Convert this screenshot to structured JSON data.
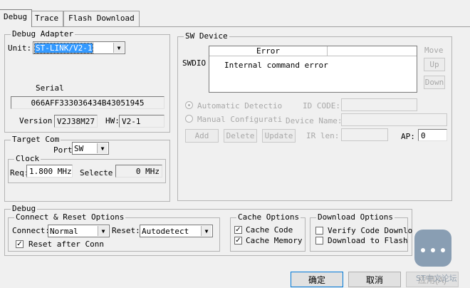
{
  "tabs": [
    {
      "label": "Debug"
    },
    {
      "label": "Trace"
    },
    {
      "label": "Flash Download"
    }
  ],
  "debug_adapter": {
    "title": "Debug Adapter",
    "unit_label": "Unit:",
    "unit_value": "ST-LINK/V2-1",
    "serial_label": "Serial",
    "serial_value": "066AFF333036434B43051945",
    "version_label": "Version:",
    "version_value": "V2J38M27",
    "hw_label": "HW:",
    "hw_value": "V2-1"
  },
  "target_com": {
    "title": "Target Com",
    "port_label": "Port",
    "port_value": "SW",
    "clock_title": "Clock",
    "req_label": "Req:",
    "req_value": "1.800 MHz",
    "selected_label": "Selecte",
    "selected_value": "0 MHz"
  },
  "sw_device": {
    "title": "SW Device",
    "swdio_label": "SWDIO",
    "column_error": "Error",
    "error_message": "Internal command error",
    "move_label": "Move",
    "up_label": "Up",
    "down_label": "Down",
    "auto_detect_label": "Automatic Detectio",
    "manual_config_label": "Manual Configurati",
    "id_code_label": "ID CODE:",
    "device_name_label": "Device Name:",
    "add_label": "Add",
    "delete_label": "Delete",
    "update_label": "Update",
    "ir_len_label": "IR len:",
    "ap_label": "AP:",
    "ap_value": "0"
  },
  "debug": {
    "title": "Debug",
    "connect_reset_title": "Connect & Reset Options",
    "connect_label": "Connect:",
    "connect_value": "Normal",
    "reset_label": "Reset:",
    "reset_value": "Autodetect",
    "reset_after_conn_label": "Reset after Conn",
    "cache_title": "Cache Options",
    "cache_code_label": "Cache Code",
    "cache_memory_label": "Cache Memory",
    "download_title": "Download Options",
    "verify_code_label": "Verify Code Downlo",
    "download_to_flash_label": "Download to Flash"
  },
  "footer": {
    "ok_label": "确定",
    "cancel_label": "取消",
    "apply_label": "应用(A)",
    "watermark_text": "ST中文论坛"
  }
}
